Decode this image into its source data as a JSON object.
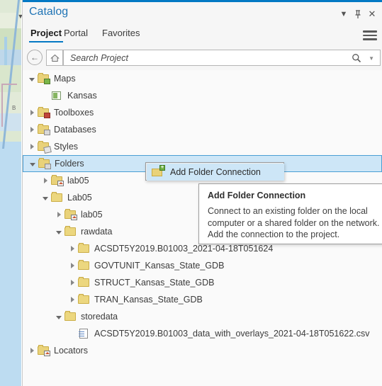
{
  "map": {
    "dropdown_icon": "chevron-down-icon",
    "label": "B"
  },
  "panel": {
    "title": "Catalog",
    "window_buttons": [
      {
        "name": "menu-arrow",
        "icon": "chevron-down-icon"
      },
      {
        "name": "pin",
        "icon": "pin-icon"
      },
      {
        "name": "close",
        "icon": "close-icon",
        "glyph": "✕"
      }
    ],
    "accent_color": "#0479c4",
    "title_color": "#1f74b5"
  },
  "tabs": [
    {
      "label": "Project",
      "active": true
    },
    {
      "label": "Portal",
      "active": false
    },
    {
      "label": "Favorites",
      "active": false
    }
  ],
  "menu_button": {
    "icon": "hamburger-menu-icon"
  },
  "search": {
    "back_icon": "back-arrow-icon",
    "home_icon": "home-icon",
    "placeholder": "Search Project",
    "value": "",
    "search_icon": "search-icon",
    "caret_icon": "chevron-down-icon"
  },
  "tree": [
    {
      "label": "Maps",
      "indent": 0,
      "expander": "open",
      "icon": "folder-maps-icon",
      "selected": false
    },
    {
      "label": "Kansas",
      "indent": 1,
      "expander": "none",
      "icon": "map-icon",
      "selected": false
    },
    {
      "label": "Toolboxes",
      "indent": 0,
      "expander": "closed",
      "icon": "folder-toolbox-icon",
      "selected": false
    },
    {
      "label": "Databases",
      "indent": 0,
      "expander": "closed",
      "icon": "folder-database-icon",
      "selected": false
    },
    {
      "label": "Styles",
      "indent": 0,
      "expander": "closed",
      "icon": "folder-styles-icon",
      "selected": false
    },
    {
      "label": "Folders",
      "indent": 0,
      "expander": "open",
      "icon": "folder-connection-icon",
      "selected": true
    },
    {
      "label": "lab05",
      "indent": 1,
      "expander": "closed",
      "icon": "folder-home-icon",
      "selected": false
    },
    {
      "label": "Lab05",
      "indent": 1,
      "expander": "open",
      "icon": "folder-plain-icon",
      "selected": false
    },
    {
      "label": "lab05",
      "indent": 2,
      "expander": "closed",
      "icon": "folder-home-icon",
      "selected": false
    },
    {
      "label": "rawdata",
      "indent": 2,
      "expander": "open",
      "icon": "folder-plain-icon",
      "selected": false
    },
    {
      "label": "ACSDT5Y2019.B01003_2021-04-18T051624",
      "indent": 3,
      "expander": "closed",
      "icon": "folder-plain-icon",
      "selected": false
    },
    {
      "label": "GOVTUNIT_Kansas_State_GDB",
      "indent": 3,
      "expander": "closed",
      "icon": "folder-plain-icon",
      "selected": false
    },
    {
      "label": "STRUCT_Kansas_State_GDB",
      "indent": 3,
      "expander": "closed",
      "icon": "folder-plain-icon",
      "selected": false
    },
    {
      "label": "TRAN_Kansas_State_GDB",
      "indent": 3,
      "expander": "closed",
      "icon": "folder-plain-icon",
      "selected": false
    },
    {
      "label": "storedata",
      "indent": 2,
      "expander": "open",
      "icon": "folder-plain-icon",
      "selected": false
    },
    {
      "label": "ACSDT5Y2019.B01003_data_with_overlays_2021-04-18T051622.csv",
      "indent": 3,
      "expander": "none",
      "icon": "csv-file-icon",
      "selected": false
    },
    {
      "label": "Locators",
      "indent": 0,
      "expander": "closed",
      "icon": "folder-locator-icon",
      "selected": false
    }
  ],
  "context_menu": {
    "item_label": "Add Folder Connection",
    "item_icon": "add-folder-connection-icon"
  },
  "tooltip": {
    "title": "Add Folder Connection",
    "body": "Connect to an existing folder on the local computer or a shared folder on the network. Add the connection to the project."
  }
}
